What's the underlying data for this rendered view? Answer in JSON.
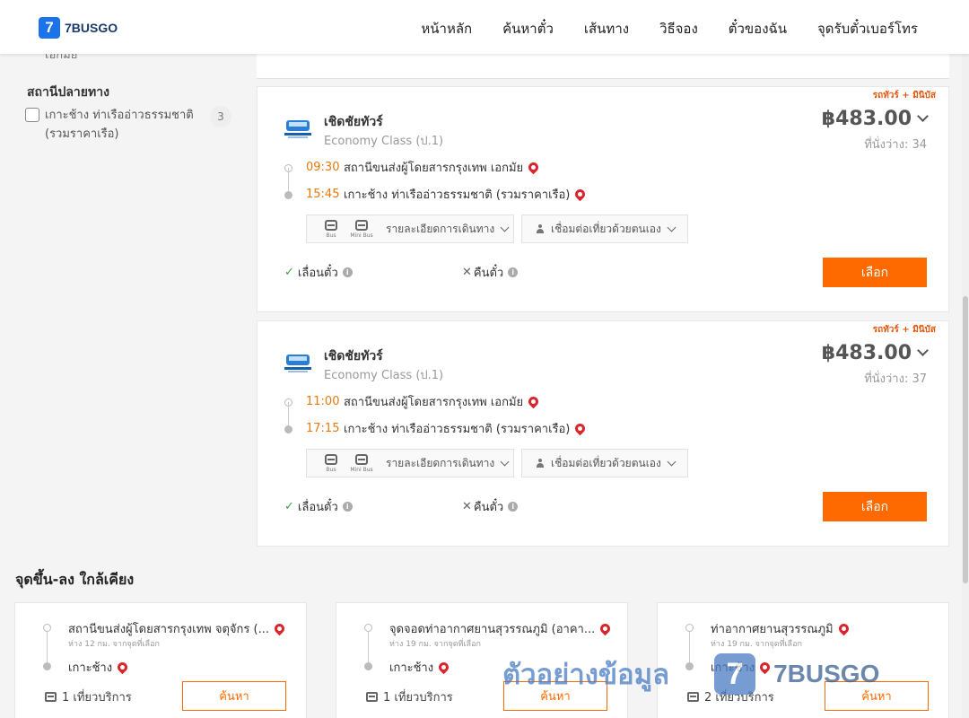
{
  "header": {
    "logo_mark": "7",
    "logo_text": "7BUSGO",
    "nav": [
      "หน้าหลัก",
      "ค้นหาตั๋ว",
      "เส้นทาง",
      "วิธีจอง",
      "ตั๋วของฉัน",
      "จุดรับตั๋วเบอร์โทร"
    ]
  },
  "sidebar": {
    "cut_text": "เอกมัย",
    "heading": "สถานีปลายทาง",
    "filter": {
      "label": "เกาะช้าง ท่าเรืออ่าวธรรมชาติ (รวมราคาเรือ)",
      "count": "3"
    }
  },
  "trips": [
    {
      "tag": "รถทัวร์ + มินิบัส",
      "operator": "เชิดชัยทัวร์",
      "class": "Economy Class (ป.1)",
      "price": "฿483.00",
      "seats": "ที่นั่งว่าง: 34",
      "depart_time": "09:30",
      "depart_place": "สถานีขนส่งผู้โดยสารกรุงเทพ เอกมัย",
      "arrive_time": "15:45",
      "arrive_place": "เกาะช้าง ท่าเรืออ่าวธรรมชาติ (รวมราคาเรือ)",
      "vehicle_1": "Bus",
      "vehicle_2": "Mini Bus",
      "details_label": "รายละเอียดการเดินทาง",
      "connect_label": "เชื่อมต่อเที่ยวด้วยตนเอง",
      "change_label": "เลื่อนตั๋ว",
      "refund_label": "คืนตั๋ว",
      "select_label": "เลือก"
    },
    {
      "tag": "รถทัวร์ + มินิบัส",
      "operator": "เชิดชัยทัวร์",
      "class": "Economy Class (ป.1)",
      "price": "฿483.00",
      "seats": "ที่นั่งว่าง: 37",
      "depart_time": "11:00",
      "depart_place": "สถานีขนส่งผู้โดยสารกรุงเทพ เอกมัย",
      "arrive_time": "17:15",
      "arrive_place": "เกาะช้าง ท่าเรืออ่าวธรรมชาติ (รวมราคาเรือ)",
      "vehicle_1": "Bus",
      "vehicle_2": "Mini Bus",
      "details_label": "รายละเอียดการเดินทาง",
      "connect_label": "เชื่อมต่อเที่ยวด้วยตนเอง",
      "change_label": "เลื่อนตั๋ว",
      "refund_label": "คืนตั๋ว",
      "select_label": "เลือก"
    }
  ],
  "nearby": {
    "title": "จุดขึ้น-ลง ใกล้เคียง",
    "cards": [
      {
        "from": "สถานีขนส่งผู้โดยสารกรุงเทพ จตุจักร (...",
        "distance": "ห่าง 12 กม. จากจุดที่เลือก",
        "to": "เกาะช้าง",
        "service": "1 เที่ยวบริการ",
        "search_label": "ค้นหา"
      },
      {
        "from": "จุดจอดท่าอากาศยานสุวรรณภูมิ (อาคา...",
        "distance": "ห่าง 19 กม. จากจุดที่เลือก",
        "to": "เกาะช้าง",
        "service": "1 เที่ยวบริการ",
        "search_label": "ค้นหา"
      },
      {
        "from": "ท่าอากาศยานสุวรรณภูมิ",
        "distance": "ห่าง 19 กม. จากจุดที่เลือก",
        "to": "เกาะช้าง",
        "service": "2 เที่ยวบริการ",
        "search_label": "ค้นหา"
      }
    ]
  },
  "watermark": {
    "thai": "ตัวอย่างข้อมูล",
    "mark": "7",
    "text": "7BUSGO"
  },
  "colors": {
    "accent": "#ff6a00",
    "brand": "#1a73e8",
    "time": "#e8790d",
    "pin": "#d8262d"
  }
}
